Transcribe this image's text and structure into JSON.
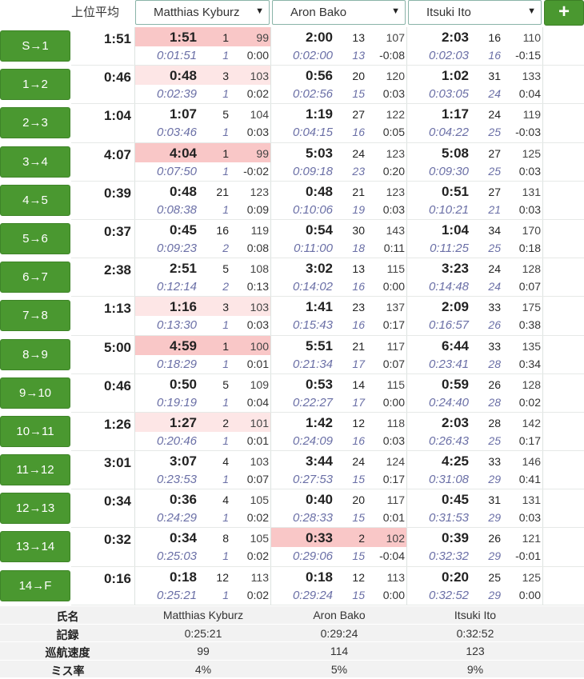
{
  "header": {
    "avg_label": "上位平均",
    "players": [
      "Matthias Kyburz",
      "Aron Bako",
      "Itsuki Ito"
    ],
    "add_label": "+"
  },
  "legs": [
    {
      "leg": "S→1",
      "avg": "1:51",
      "p": [
        {
          "t": "1:51",
          "r": "1",
          "pct": "99",
          "c": "0:01:51",
          "cr": "1",
          "d": "0:00",
          "hl": 1
        },
        {
          "t": "2:00",
          "r": "13",
          "pct": "107",
          "c": "0:02:00",
          "cr": "13",
          "d": "-0:08",
          "hl": 0
        },
        {
          "t": "2:03",
          "r": "16",
          "pct": "110",
          "c": "0:02:03",
          "cr": "16",
          "d": "-0:15",
          "hl": 0
        }
      ]
    },
    {
      "leg": "1→2",
      "avg": "0:46",
      "p": [
        {
          "t": "0:48",
          "r": "3",
          "pct": "103",
          "c": "0:02:39",
          "cr": "1",
          "d": "0:02",
          "hl": 2
        },
        {
          "t": "0:56",
          "r": "20",
          "pct": "120",
          "c": "0:02:56",
          "cr": "15",
          "d": "0:03",
          "hl": 0
        },
        {
          "t": "1:02",
          "r": "31",
          "pct": "133",
          "c": "0:03:05",
          "cr": "24",
          "d": "0:04",
          "hl": 0
        }
      ]
    },
    {
      "leg": "2→3",
      "avg": "1:04",
      "p": [
        {
          "t": "1:07",
          "r": "5",
          "pct": "104",
          "c": "0:03:46",
          "cr": "1",
          "d": "0:03",
          "hl": 0
        },
        {
          "t": "1:19",
          "r": "27",
          "pct": "122",
          "c": "0:04:15",
          "cr": "16",
          "d": "0:05",
          "hl": 0
        },
        {
          "t": "1:17",
          "r": "24",
          "pct": "119",
          "c": "0:04:22",
          "cr": "25",
          "d": "-0:03",
          "hl": 0
        }
      ]
    },
    {
      "leg": "3→4",
      "avg": "4:07",
      "p": [
        {
          "t": "4:04",
          "r": "1",
          "pct": "99",
          "c": "0:07:50",
          "cr": "1",
          "d": "-0:02",
          "hl": 1
        },
        {
          "t": "5:03",
          "r": "24",
          "pct": "123",
          "c": "0:09:18",
          "cr": "23",
          "d": "0:20",
          "hl": 0
        },
        {
          "t": "5:08",
          "r": "27",
          "pct": "125",
          "c": "0:09:30",
          "cr": "25",
          "d": "0:03",
          "hl": 0
        }
      ]
    },
    {
      "leg": "4→5",
      "avg": "0:39",
      "p": [
        {
          "t": "0:48",
          "r": "21",
          "pct": "123",
          "c": "0:08:38",
          "cr": "1",
          "d": "0:09",
          "hl": 0
        },
        {
          "t": "0:48",
          "r": "21",
          "pct": "123",
          "c": "0:10:06",
          "cr": "19",
          "d": "0:03",
          "hl": 0
        },
        {
          "t": "0:51",
          "r": "27",
          "pct": "131",
          "c": "0:10:21",
          "cr": "21",
          "d": "0:03",
          "hl": 0
        }
      ]
    },
    {
      "leg": "5→6",
      "avg": "0:37",
      "p": [
        {
          "t": "0:45",
          "r": "16",
          "pct": "119",
          "c": "0:09:23",
          "cr": "2",
          "d": "0:08",
          "hl": 0
        },
        {
          "t": "0:54",
          "r": "30",
          "pct": "143",
          "c": "0:11:00",
          "cr": "18",
          "d": "0:11",
          "hl": 0
        },
        {
          "t": "1:04",
          "r": "34",
          "pct": "170",
          "c": "0:11:25",
          "cr": "25",
          "d": "0:18",
          "hl": 0
        }
      ]
    },
    {
      "leg": "6→7",
      "avg": "2:38",
      "p": [
        {
          "t": "2:51",
          "r": "5",
          "pct": "108",
          "c": "0:12:14",
          "cr": "2",
          "d": "0:13",
          "hl": 0
        },
        {
          "t": "3:02",
          "r": "13",
          "pct": "115",
          "c": "0:14:02",
          "cr": "16",
          "d": "0:00",
          "hl": 0
        },
        {
          "t": "3:23",
          "r": "24",
          "pct": "128",
          "c": "0:14:48",
          "cr": "24",
          "d": "0:07",
          "hl": 0
        }
      ]
    },
    {
      "leg": "7→8",
      "avg": "1:13",
      "p": [
        {
          "t": "1:16",
          "r": "3",
          "pct": "103",
          "c": "0:13:30",
          "cr": "1",
          "d": "0:03",
          "hl": 2
        },
        {
          "t": "1:41",
          "r": "23",
          "pct": "137",
          "c": "0:15:43",
          "cr": "16",
          "d": "0:17",
          "hl": 0
        },
        {
          "t": "2:09",
          "r": "33",
          "pct": "175",
          "c": "0:16:57",
          "cr": "26",
          "d": "0:38",
          "hl": 0
        }
      ]
    },
    {
      "leg": "8→9",
      "avg": "5:00",
      "p": [
        {
          "t": "4:59",
          "r": "1",
          "pct": "100",
          "c": "0:18:29",
          "cr": "1",
          "d": "0:01",
          "hl": 1
        },
        {
          "t": "5:51",
          "r": "21",
          "pct": "117",
          "c": "0:21:34",
          "cr": "17",
          "d": "0:07",
          "hl": 0
        },
        {
          "t": "6:44",
          "r": "33",
          "pct": "135",
          "c": "0:23:41",
          "cr": "28",
          "d": "0:34",
          "hl": 0
        }
      ]
    },
    {
      "leg": "9→10",
      "avg": "0:46",
      "p": [
        {
          "t": "0:50",
          "r": "5",
          "pct": "109",
          "c": "0:19:19",
          "cr": "1",
          "d": "0:04",
          "hl": 0
        },
        {
          "t": "0:53",
          "r": "14",
          "pct": "115",
          "c": "0:22:27",
          "cr": "17",
          "d": "0:00",
          "hl": 0
        },
        {
          "t": "0:59",
          "r": "26",
          "pct": "128",
          "c": "0:24:40",
          "cr": "28",
          "d": "0:02",
          "hl": 0
        }
      ]
    },
    {
      "leg": "10→11",
      "avg": "1:26",
      "p": [
        {
          "t": "1:27",
          "r": "2",
          "pct": "101",
          "c": "0:20:46",
          "cr": "1",
          "d": "0:01",
          "hl": 2
        },
        {
          "t": "1:42",
          "r": "12",
          "pct": "118",
          "c": "0:24:09",
          "cr": "16",
          "d": "0:03",
          "hl": 0
        },
        {
          "t": "2:03",
          "r": "28",
          "pct": "142",
          "c": "0:26:43",
          "cr": "25",
          "d": "0:17",
          "hl": 0
        }
      ]
    },
    {
      "leg": "11→12",
      "avg": "3:01",
      "p": [
        {
          "t": "3:07",
          "r": "4",
          "pct": "103",
          "c": "0:23:53",
          "cr": "1",
          "d": "0:07",
          "hl": 0
        },
        {
          "t": "3:44",
          "r": "24",
          "pct": "124",
          "c": "0:27:53",
          "cr": "15",
          "d": "0:17",
          "hl": 0
        },
        {
          "t": "4:25",
          "r": "33",
          "pct": "146",
          "c": "0:31:08",
          "cr": "29",
          "d": "0:41",
          "hl": 0
        }
      ]
    },
    {
      "leg": "12→13",
      "avg": "0:34",
      "p": [
        {
          "t": "0:36",
          "r": "4",
          "pct": "105",
          "c": "0:24:29",
          "cr": "1",
          "d": "0:02",
          "hl": 0
        },
        {
          "t": "0:40",
          "r": "20",
          "pct": "117",
          "c": "0:28:33",
          "cr": "15",
          "d": "0:01",
          "hl": 0
        },
        {
          "t": "0:45",
          "r": "31",
          "pct": "131",
          "c": "0:31:53",
          "cr": "29",
          "d": "0:03",
          "hl": 0
        }
      ]
    },
    {
      "leg": "13→14",
      "avg": "0:32",
      "p": [
        {
          "t": "0:34",
          "r": "8",
          "pct": "105",
          "c": "0:25:03",
          "cr": "1",
          "d": "0:02",
          "hl": 0
        },
        {
          "t": "0:33",
          "r": "2",
          "pct": "102",
          "c": "0:29:06",
          "cr": "15",
          "d": "-0:04",
          "hl": 1
        },
        {
          "t": "0:39",
          "r": "26",
          "pct": "121",
          "c": "0:32:32",
          "cr": "29",
          "d": "-0:01",
          "hl": 0
        }
      ]
    },
    {
      "leg": "14→F",
      "avg": "0:16",
      "p": [
        {
          "t": "0:18",
          "r": "12",
          "pct": "113",
          "c": "0:25:21",
          "cr": "1",
          "d": "0:02",
          "hl": 0
        },
        {
          "t": "0:18",
          "r": "12",
          "pct": "113",
          "c": "0:29:24",
          "cr": "15",
          "d": "0:00",
          "hl": 0
        },
        {
          "t": "0:20",
          "r": "25",
          "pct": "125",
          "c": "0:32:52",
          "cr": "29",
          "d": "0:00",
          "hl": 0
        }
      ]
    }
  ],
  "summary": [
    {
      "label": "氏名",
      "values": [
        "Matthias Kyburz",
        "Aron Bako",
        "Itsuki Ito"
      ]
    },
    {
      "label": "記録",
      "values": [
        "0:25:21",
        "0:29:24",
        "0:32:52"
      ]
    },
    {
      "label": "巡航速度",
      "values": [
        "99",
        "114",
        "123"
      ]
    },
    {
      "label": "ミス率",
      "values": [
        "4%",
        "5%",
        "9%"
      ]
    }
  ],
  "colors": {
    "button_green": "#4a9830",
    "highlight_strong": "#f9c7c7",
    "highlight_light": "#fde6e6",
    "cumulative_text": "#6a6fa6"
  }
}
